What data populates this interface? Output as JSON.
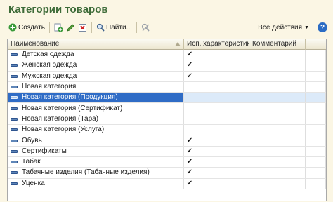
{
  "window": {
    "title": "Категории товаров"
  },
  "toolbar": {
    "create_label": "Создать",
    "find_label": "Найти...",
    "all_actions_label": "Все действия",
    "help_label": "?"
  },
  "grid": {
    "columns": [
      "Наименование",
      "Исп. характеристики",
      "Комментарий"
    ],
    "rows": [
      {
        "name": "Детская одежда",
        "char": "✔",
        "comment": ""
      },
      {
        "name": "Женская одежда",
        "char": "✔",
        "comment": ""
      },
      {
        "name": "Мужская одежда",
        "char": "✔",
        "comment": ""
      },
      {
        "name": "Новая категория",
        "char": "",
        "comment": ""
      },
      {
        "name": "Новая категория (Продукция)",
        "char": "",
        "comment": "",
        "selected": true
      },
      {
        "name": "Новая категория (Сертификат)",
        "char": "",
        "comment": ""
      },
      {
        "name": "Новая категория (Тара)",
        "char": "",
        "comment": ""
      },
      {
        "name": "Новая категория (Услуга)",
        "char": "",
        "comment": ""
      },
      {
        "name": "Обувь",
        "char": "✔",
        "comment": ""
      },
      {
        "name": "Сертификаты",
        "char": "✔",
        "comment": ""
      },
      {
        "name": "Табак",
        "char": "✔",
        "comment": ""
      },
      {
        "name": "Табачные изделия (Табачные изделия)",
        "char": "✔",
        "comment": ""
      },
      {
        "name": "Уценка",
        "char": "✔",
        "comment": ""
      }
    ]
  },
  "colors": {
    "title": "#3d6b38",
    "selection": "#2f6cc6",
    "background": "#fbf6e4"
  }
}
